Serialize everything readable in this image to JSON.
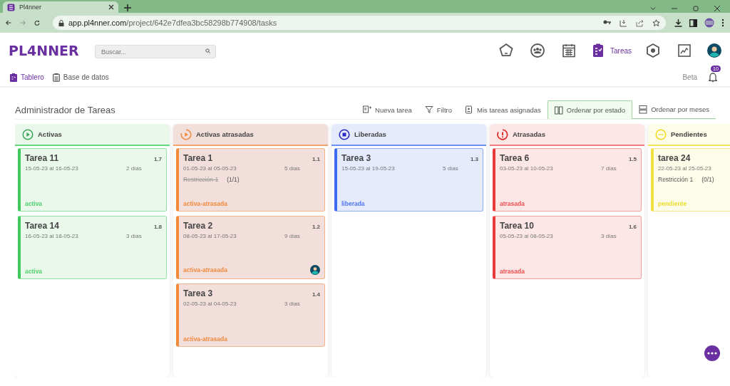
{
  "browser": {
    "tab_title": "Pl4nner",
    "url_host": "app.pl4nner.com",
    "url_path": "/project/642e7dfea3bc58298b774908/tasks"
  },
  "app": {
    "logo": "PL4NNER",
    "search": {
      "placeholder": "Buscar..."
    },
    "nav": [
      {
        "kind": "pentagon",
        "selected": false
      },
      {
        "kind": "group",
        "selected": false
      },
      {
        "kind": "calendar",
        "selected": false
      },
      {
        "kind": "tasks",
        "label": "Tareas",
        "selected": true
      },
      {
        "kind": "hexagon",
        "selected": false
      },
      {
        "kind": "chart",
        "selected": false
      }
    ],
    "subnav": [
      {
        "kind": "board",
        "label": "Tablero",
        "selected": true
      },
      {
        "kind": "database",
        "label": "Base de datos",
        "selected": false
      }
    ],
    "beta": "Beta",
    "notifications": "10"
  },
  "title": "Administrador de Tareas",
  "toolbar": [
    {
      "kind": "new",
      "label": "Nueva tarea",
      "selected": false
    },
    {
      "kind": "filter",
      "label": "Filtro",
      "selected": false
    },
    {
      "kind": "assigned",
      "label": "Mis tareas asignadas",
      "selected": false
    },
    {
      "kind": "by-state",
      "label": "Ordenar por estado",
      "selected": true
    },
    {
      "kind": "by-month",
      "label": "Ordenar por meses",
      "selected": false
    }
  ],
  "columns": [
    {
      "kind": "activas",
      "title": "Activas",
      "cards": [
        {
          "title": "Tarea 11",
          "code": "1.7",
          "dates": "15-05-23 al 16-05-23",
          "duration": "2 días",
          "status": "activa",
          "assigned": false
        },
        {
          "title": "Tarea 14",
          "code": "1.8",
          "dates": "16-05-23 al 18-05-23",
          "duration": "3 días",
          "status": "activa",
          "assigned": false
        }
      ]
    },
    {
      "kind": "activas-atrasadas",
      "title": "Activas atrasadas",
      "cards": [
        {
          "title": "Tarea 1",
          "code": "1.1",
          "dates": "01-05-23 al 05-05-23",
          "duration": "5 días",
          "restriction": {
            "label": "Restricción 1",
            "count": "(1/1)",
            "done": true
          },
          "status": "activa-atrasada",
          "assigned": false
        },
        {
          "title": "Tarea 2",
          "code": "1.2",
          "dates": "08-05-23 al 17-05-23",
          "duration": "9 días",
          "status": "activa-atrasada",
          "assigned": true
        },
        {
          "title": "Tarea 3",
          "code": "1.4",
          "dates": "02-05-23 al 04-05-23",
          "duration": "3 días",
          "status": "activa-atrasada",
          "assigned": false
        }
      ]
    },
    {
      "kind": "liberadas",
      "title": "Liberadas",
      "cards": [
        {
          "title": "Tarea 3",
          "code": "1.3",
          "dates": "15-05-23 al 19-05-23",
          "duration": "5 días",
          "status": "liberada",
          "assigned": false
        }
      ]
    },
    {
      "kind": "atrasadas",
      "title": "Atrasadas",
      "cards": [
        {
          "title": "Tarea 6",
          "code": "1.5",
          "dates": "03-05-23 al 10-05-23",
          "duration": "7 días",
          "status": "atrasada",
          "assigned": false
        },
        {
          "title": "Tarea 10",
          "code": "1.6",
          "dates": "05-05-23 al 08-05-23",
          "duration": "3 días",
          "status": "atrasada",
          "assigned": false
        }
      ]
    },
    {
      "kind": "pendientes",
      "title": "Pendientes",
      "cards": [
        {
          "title": "tarea 24",
          "dates": "22-05-23 al 25-05-23",
          "restriction": {
            "label": "Restricción 1",
            "count": "(0/1)",
            "done": false
          },
          "status": "pendiente",
          "assigned": false
        }
      ]
    }
  ]
}
